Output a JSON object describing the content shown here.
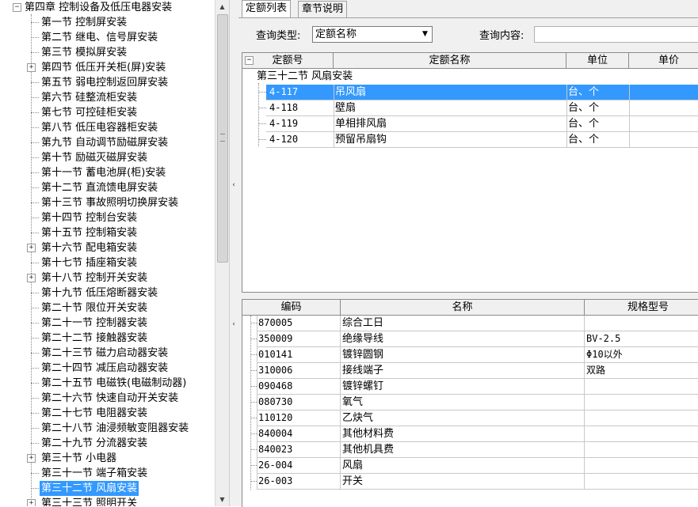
{
  "tree": {
    "root_label": "第四章 控制设备及低压电器安装",
    "root_expander": "−",
    "items": [
      {
        "label": "第一节 控制屏安装",
        "expandable": false
      },
      {
        "label": "第二节 继电、信号屏安装",
        "expandable": false
      },
      {
        "label": "第三节 模拟屏安装",
        "expandable": false
      },
      {
        "label": "第四节 低压开关柜(屏)安装",
        "expandable": true
      },
      {
        "label": "第五节 弱电控制返回屏安装",
        "expandable": false
      },
      {
        "label": "第六节 硅整流柜安装",
        "expandable": false
      },
      {
        "label": "第七节 可控硅柜安装",
        "expandable": false
      },
      {
        "label": "第八节 低压电容器柜安装",
        "expandable": false
      },
      {
        "label": "第九节 自动调节励磁屏安装",
        "expandable": false
      },
      {
        "label": "第十节 励磁灭磁屏安装",
        "expandable": false
      },
      {
        "label": "第十一节 蓄电池屏(柜)安装",
        "expandable": false
      },
      {
        "label": "第十二节 直流馈电屏安装",
        "expandable": false
      },
      {
        "label": "第十三节 事故照明切换屏安装",
        "expandable": false
      },
      {
        "label": "第十四节 控制台安装",
        "expandable": false
      },
      {
        "label": "第十五节 控制箱安装",
        "expandable": false
      },
      {
        "label": "第十六节 配电箱安装",
        "expandable": true
      },
      {
        "label": "第十七节 插座箱安装",
        "expandable": false
      },
      {
        "label": "第十八节 控制开关安装",
        "expandable": true
      },
      {
        "label": "第十九节 低压熔断器安装",
        "expandable": false
      },
      {
        "label": "第二十节 限位开关安装",
        "expandable": false
      },
      {
        "label": "第二十一节 控制器安装",
        "expandable": false
      },
      {
        "label": "第二十二节 接触器安装",
        "expandable": false
      },
      {
        "label": "第二十三节 磁力启动器安装",
        "expandable": false
      },
      {
        "label": "第二十四节 减压启动器安装",
        "expandable": false
      },
      {
        "label": "第二十五节 电磁铁(电磁制动器)",
        "expandable": false
      },
      {
        "label": "第二十六节 快速自动开关安装",
        "expandable": false
      },
      {
        "label": "第二十七节 电阻器安装",
        "expandable": false
      },
      {
        "label": "第二十八节 油浸频敏变阻器安装",
        "expandable": false
      },
      {
        "label": "第二十九节 分流器安装",
        "expandable": false
      },
      {
        "label": "第三十节 小电器",
        "expandable": true
      },
      {
        "label": "第三十一节 端子箱安装",
        "expandable": false
      },
      {
        "label": "第三十二节 风扇安装",
        "expandable": false,
        "selected": true
      },
      {
        "label": "第三十三节 照明开关",
        "expandable": true
      }
    ]
  },
  "tabs": [
    {
      "label": "定额列表",
      "active": true
    },
    {
      "label": "章节说明",
      "active": false
    }
  ],
  "query": {
    "type_label": "查询类型:",
    "type_value": "定额名称",
    "content_label": "查询内容:",
    "content_value": ""
  },
  "quota_table": {
    "columns": [
      "定额号",
      "定额名称",
      "单位",
      "单价"
    ],
    "group_label": "第三十二节 风扇安装",
    "group_expander": "−",
    "rows": [
      {
        "code": "4-117",
        "name": "吊风扇",
        "unit": "台、个",
        "price": "",
        "selected": true
      },
      {
        "code": "4-118",
        "name": "壁扇",
        "unit": "台、个",
        "price": ""
      },
      {
        "code": "4-119",
        "name": "单相排风扇",
        "unit": "台、个",
        "price": ""
      },
      {
        "code": "4-120",
        "name": "预留吊扇钩",
        "unit": "台、个",
        "price": ""
      }
    ]
  },
  "material_table": {
    "columns": [
      "编码",
      "名称",
      "规格型号"
    ],
    "rows": [
      {
        "code": "870005",
        "name": "综合工日",
        "spec": ""
      },
      {
        "code": "350009",
        "name": "绝缘导线",
        "spec": "BV-2.5"
      },
      {
        "code": "010141",
        "name": "镀锌圆钢",
        "spec": "Φ10以外"
      },
      {
        "code": "310006",
        "name": "接线端子",
        "spec": "双路"
      },
      {
        "code": "090468",
        "name": "镀锌螺钉",
        "spec": ""
      },
      {
        "code": "080730",
        "name": "氧气",
        "spec": ""
      },
      {
        "code": "110120",
        "name": "乙炔气",
        "spec": ""
      },
      {
        "code": "840004",
        "name": "其他材料费",
        "spec": ""
      },
      {
        "code": "840023",
        "name": "其他机具费",
        "spec": ""
      },
      {
        "code": "26-004",
        "name": "风扇",
        "spec": ""
      },
      {
        "code": "26-003",
        "name": "开关",
        "spec": ""
      }
    ]
  },
  "colors": {
    "selection": "#3399ff",
    "background": "#f0f0f0"
  }
}
